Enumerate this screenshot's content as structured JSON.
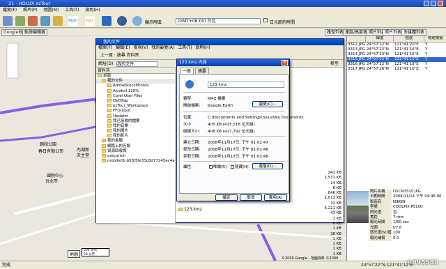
{
  "window": {
    "title": "21 - HOLUX ezTour"
  },
  "menu": [
    "檔案(F)",
    "照片(P)",
    "地圖(M)",
    "工具(T)",
    "說明(H)"
  ],
  "toolbar": {
    "labels": [
      "",
      "",
      "",
      "flickr",
      "locr",
      "",
      "",
      ""
    ],
    "show_zone_label": "顯示時區",
    "timezone": "(GMT+08:00) 台北",
    "dst_label": "日光節約時間"
  },
  "tabs_left": [
    "Google地圖",
    "軌跡編輯器"
  ],
  "tabs_right": [
    "路徑列表",
    "速度/高度表",
    "照片列表",
    "照片列表",
    "多媒體列表"
  ],
  "map": {
    "labels": {
      "park": "朝和公園",
      "company": "春日有限公司",
      "jinpu1": "內湖新",
      "jinpu2": "天主堂",
      "scale1": "200 英呎",
      "scale2": "50 公尺",
      "map_btn": "地圖",
      "copyright": "©2009 Google - 地圖資料 ©2009"
    },
    "places": [
      "國稅中心",
      "台北市",
      "國稅局",
      "南京東路店"
    ]
  },
  "explorer": {
    "title": "我的文件",
    "menu": [
      "檔案(F)",
      "編輯(E)",
      "檢視(V)",
      "我的最愛(A)",
      "工具(T)",
      "說明(H)"
    ],
    "toolbar": "上一頁  ·  搜尋  資料夾",
    "addr_label": "網址(D)",
    "addr_value": "我的文件",
    "go": "移至",
    "tree_header": "資料夾",
    "tree": [
      "桌面",
      "我的文件",
      "AdobeStockPhotos",
      "Alcohol 120%",
      "Corel User Files",
      "DVDFab",
      "ezTour_Workspace",
      "FFOutput",
      "Updater",
      "我已接收的檔案",
      "我的音樂",
      "我的圖片",
      "我的影片",
      "我的電腦",
      "網路上的芳鄰",
      "資源回收筒",
      "eztourtch",
      "mobile01-b53f5fe33c8d77245ec4a4357654"
    ],
    "sizes": [
      "341 KB",
      "1,531 KB",
      "24 KB",
      "8 KB",
      "846 KB",
      "1,013 KB",
      "32 KB",
      "5,221 KB",
      "43 KB",
      "1 KB",
      "6 KB",
      "1 KB",
      "38 KB",
      "1 KB",
      "1 KB",
      "1 KB",
      "1 KB"
    ],
    "file": "123.kmz"
  },
  "dialog": {
    "title": "123.kmz 內容",
    "tabs": [
      "一般",
      "摘要"
    ],
    "filename": "123.kmz",
    "rows": [
      {
        "k": "類型:",
        "v": "KMZ 檔案"
      },
      {
        "k": "開啟檔案:",
        "v": "Google Earth"
      }
    ],
    "change": "變更(C)...",
    "loc": [
      {
        "k": "位置:",
        "v": "C:\\Documents and Settings\\holux\\My Documents"
      },
      {
        "k": "大小:",
        "v": "405 KB (415,516 位元組)"
      },
      {
        "k": "磁碟大小:",
        "v": "408 KB (417,792 位元組)"
      }
    ],
    "dates": [
      {
        "k": "建立日期:",
        "v": "2008年11月17日, 下午 01:02:47"
      },
      {
        "k": "修改日期:",
        "v": "2008年11月17日, 下午 01:02:48"
      },
      {
        "k": "存取日期:",
        "v": "2008年11月17日, 下午 01:02:48"
      }
    ],
    "attr_label": "屬性:",
    "readonly": "唯讀(R)",
    "hidden": "隱藏(H)",
    "advanced": "進階(D)...",
    "buttons": [
      "確定",
      "取消",
      "套用(A)"
    ]
  },
  "photo_table": {
    "headers": [
      "",
      "緯度",
      "經度",
      "地理標籤"
    ],
    "rows": [
      [
        "3312.JPG",
        "24°57'22\"N",
        "121°41'20\"E",
        "Y"
      ],
      [
        "3313.JPG",
        "24°57'22\"N",
        "121°41'16\"E",
        "Y"
      ],
      [
        "3314.JPG",
        "24°57'23\"N",
        "121°41'16\"E",
        "Y"
      ],
      [
        "3315.JPG",
        "24°57'22\"N",
        "121°41'12\"E",
        "Y"
      ],
      [
        "3316.JPG",
        "24°57'22\"N",
        "121°41'18\"E",
        "Y"
      ],
      [
        "3317.JPG",
        "24°57'26\"N",
        "121°41'16\"E",
        "Y"
      ]
    ],
    "selected": 3
  },
  "photo_info": [
    [
      "照片名稱",
      "DSCN3315.JPG"
    ],
    [
      "日期時間",
      "2008/11/14 下午 04:45:00"
    ],
    [
      "製造商",
      "NIKON"
    ],
    [
      "型號",
      "COOLPIX P5100"
    ],
    [
      "閃光燈",
      "否"
    ],
    [
      "焦距",
      "7 mm"
    ],
    [
      "曝光時間",
      "1/60 sec"
    ],
    [
      "光圈",
      "f/7.6"
    ],
    [
      "感光度ISO值",
      "100"
    ],
    [
      "曝光補償",
      "0.0"
    ]
  ],
  "status": {
    "left": "完成",
    "coords": "24°57'22\"N 121°41'12\"E",
    "watermark": "#995589"
  }
}
